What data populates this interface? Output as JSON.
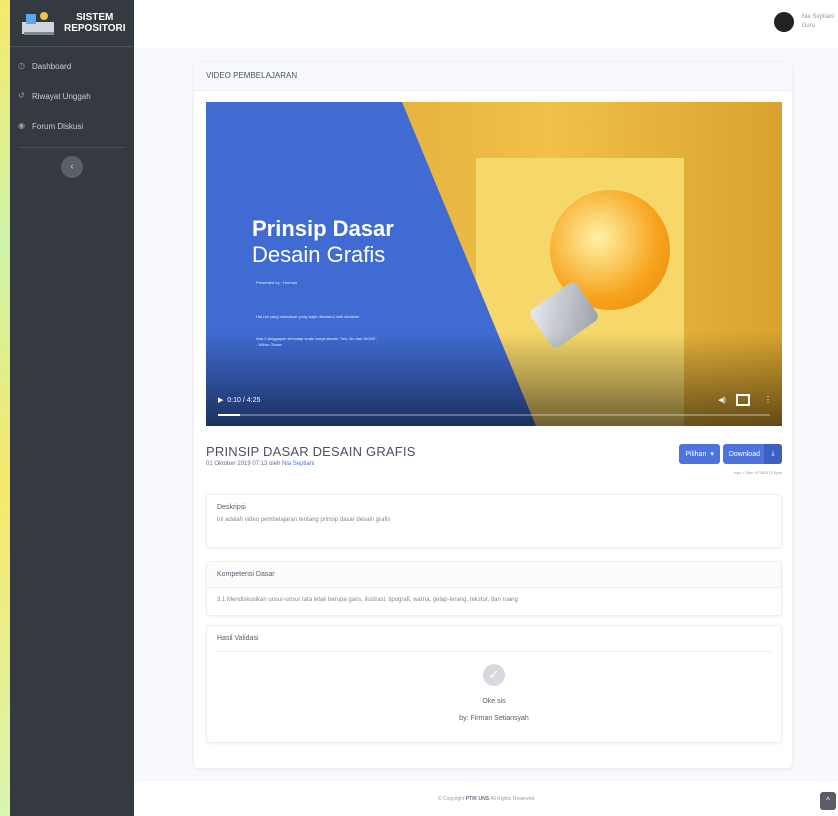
{
  "app": {
    "brand_line1": "SISTEM",
    "brand_line2": "REPOSITORI"
  },
  "sidebar": {
    "items": [
      {
        "label": "Dashboard",
        "icon": "dashboard-icon"
      },
      {
        "label": "Riwayat Unggah",
        "icon": "history-icon"
      },
      {
        "label": "Forum Diskusi",
        "icon": "forum-icon"
      }
    ],
    "toggle_icon": "chevron-left-icon"
  },
  "topbar": {
    "user_name": "Nia Septiani",
    "user_role": "Guru"
  },
  "page": {
    "card_title": "VIDEO PEMBELAJARAN"
  },
  "video": {
    "slide_title_1": "Prinsip Dasar",
    "slide_title_2": "Desain Grafis",
    "presented_by": "Presented by : Herman",
    "slide_line_1": "Hal-hal yang mendasar yang wajib diketahui oleh desainer",
    "slide_line_2": "Ada 3 tanggapan terhadap suatu karya desain \"Yes, No dan WOW!\"",
    "slide_line_3": "- Milton Glaser",
    "time": "0:10 / 4:25",
    "progress": 0.04
  },
  "detail": {
    "title": "PRINSIP DASAR DESAIN GRAFIS",
    "date": "01 Oktober 2019 07:13 oleh ",
    "author": "Nia Septiani",
    "pilihan_label": "Pilihan",
    "download_label": "Download",
    "file_meta": "mp4 • Size: 97383175 Byte"
  },
  "deskripsi": {
    "title": "Deskripsi",
    "text": "Ini adalah video pembelajaran tentang prinsip dasar desain grafis"
  },
  "kompetensi": {
    "title": "Kompetensi Dasar",
    "text": "3.1 Mendiskusikan unsur-unsur tata letak berupa garis, ilustrasi, tipografi, warna, gelap-terang, tekstur, dan ruang"
  },
  "validasi": {
    "title": "Hasil Validasi",
    "status": "Oke sis",
    "by": "by: Firman Setiansyah"
  },
  "footer": {
    "prefix": "© Copyright ",
    "org": "PTIK UNS",
    "suffix": " All Rights Reserved"
  },
  "colors": {
    "primary": "#4e73df",
    "sidebar": "#343a40"
  }
}
